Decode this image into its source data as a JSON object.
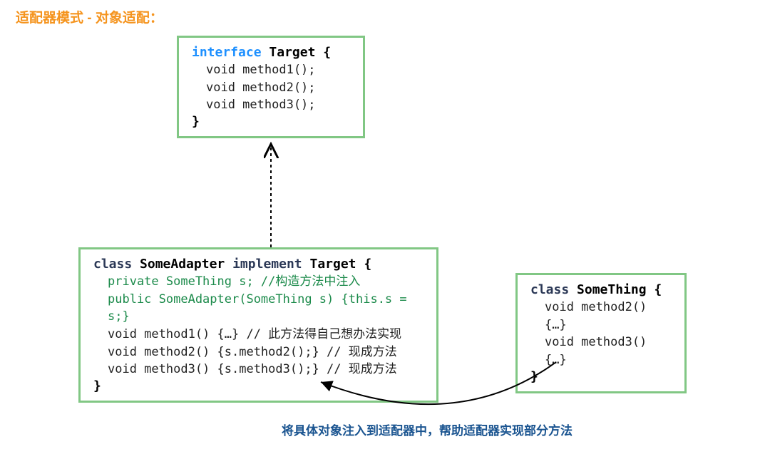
{
  "title": "适配器模式 - 对象适配：",
  "target": {
    "kw": "interface",
    "name": "Target",
    "brace_open": "{",
    "lines": [
      "void method1();",
      "void method2();",
      "void method3();"
    ],
    "brace_close": "}"
  },
  "adapter": {
    "kw_class": "class",
    "name": "SomeAdapter",
    "kw_impl": "implement",
    "impl_name": "Target",
    "brace_open": "{",
    "line1": "private SomeThing s; //构造方法中注入",
    "line2": "public SomeAdapter(SomeThing s) {this.s = s;}",
    "line3": "void method1() {…} // 此方法得自己想办法实现",
    "line4": "void method2() {s.method2();} // 现成方法",
    "line5": "void method3() {s.method3();} // 现成方法",
    "brace_close": "}"
  },
  "something": {
    "kw_class": "class",
    "name": "SomeThing",
    "brace_open": "{",
    "lines": [
      "void method2() {…}",
      "void method3() {…}"
    ],
    "brace_close": "}"
  },
  "caption": "将具体对象注入到适配器中，帮助适配器实现部分方法"
}
